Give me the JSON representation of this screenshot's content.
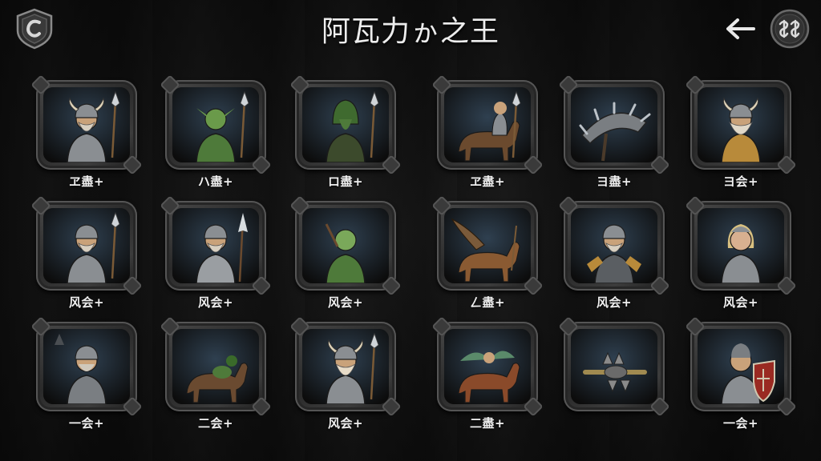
{
  "header": {
    "title": "阿瓦力ゕ之王",
    "emblem_icon": "shield-emblem-icon",
    "back_icon": "arrow-left-icon",
    "currency_icon": "currency-exchange-icon"
  },
  "colors": {
    "background": "#141414",
    "frame": "#3a3a3a",
    "text": "#f0f0f0"
  },
  "units": [
    {
      "label": "ヱ盡+",
      "art": "viking-warrior",
      "bg": "#2f4050"
    },
    {
      "label": "ハ盡+",
      "art": "goblin-spearman",
      "bg": "#3d5a2e"
    },
    {
      "label": "ロ盡+",
      "art": "hooded-elf-warrior",
      "bg": "#2e3a2a"
    },
    {
      "label": "ヱ盡+",
      "art": "centaur-spearman",
      "bg": "#3b5a6e"
    },
    {
      "label": "ヨ盡+",
      "art": "spiked-war-shield",
      "bg": "#5a5c5e"
    },
    {
      "label": "ヨ会+",
      "art": "horned-dwarf-king",
      "bg": "#24303a"
    },
    {
      "label": "风会+",
      "art": "dwarf-spearman",
      "bg": "#2c3a4a"
    },
    {
      "label": "风会+",
      "art": "armored-dwarf-halberdier",
      "bg": "#343a40"
    },
    {
      "label": "风会+",
      "art": "green-goblin-brawler",
      "bg": "#3e5a30"
    },
    {
      "label": "ㄥ盡+",
      "art": "winged-horse-rider",
      "bg": "#34485a"
    },
    {
      "label": "风会+",
      "art": "bearded-dwarf-knight",
      "bg": "#22282e"
    },
    {
      "label": "风会+",
      "art": "elf-knight",
      "bg": "#3a4a52"
    },
    {
      "label": "一会+",
      "art": "armored-knight",
      "bg": "#2a3036"
    },
    {
      "label": "二会+",
      "art": "horse-rider",
      "bg": "#283440"
    },
    {
      "label": "风会+",
      "art": "viking-chieftain",
      "bg": "#3a4048"
    },
    {
      "label": "二盡+",
      "art": "griffin-rider",
      "bg": "#3e5a4a"
    },
    {
      "label": "",
      "art": "spiked-mace",
      "bg": "#202428"
    },
    {
      "label": "一会+",
      "art": "shield-knight",
      "bg": "#2c3a48"
    }
  ]
}
